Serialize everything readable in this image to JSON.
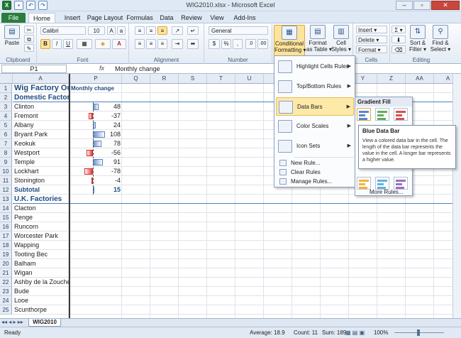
{
  "window": {
    "title": "WIG2010.xlsx  -  Microsoft Excel",
    "minimize": "–",
    "restore": "▫",
    "close": "✕"
  },
  "tabs": [
    "File",
    "Home",
    "Insert",
    "Page Layout",
    "Formulas",
    "Data",
    "Review",
    "View",
    "Add-Ins"
  ],
  "ribbon": {
    "clipboard": {
      "label": "Clipboard",
      "paste": "Paste"
    },
    "font": {
      "label": "Font",
      "name": "Calibri",
      "size": "10",
      "bold": "B",
      "italic": "I",
      "underline": "U"
    },
    "alignment": {
      "label": "Alignment"
    },
    "number": {
      "label": "Number",
      "format": "General",
      "currency": "$",
      "percent": "%",
      "comma": ",",
      "inc": ".0",
      "dec": ".00"
    },
    "styles": {
      "conditional": "Conditional\nFormatting ▾",
      "format_table": "Format\nas Table ▾",
      "cell_styles": "Cell\nStyles ▾"
    },
    "cells": {
      "label": "Cells",
      "insert": "Insert ▾",
      "delete": "Delete ▾",
      "format": "Format ▾"
    },
    "editing": {
      "label": "Editing",
      "sum": "Σ ▾",
      "sort": "Sort &\nFilter ▾",
      "find": "Find &\nSelect ▾"
    }
  },
  "formula_bar": {
    "name_box": "P1",
    "fx": "fx",
    "value": "Monthly change"
  },
  "columns": [
    "A",
    "P",
    "Q",
    "R",
    "S",
    "T",
    "U",
    "V",
    "W",
    "X",
    "Y",
    "Z",
    "AA",
    "A"
  ],
  "rows": [
    {
      "n": "1",
      "a": "Wig Factory Ou",
      "p": "Monthly change",
      "v": null,
      "style": "title"
    },
    {
      "n": "2",
      "a": "Domestic Factories",
      "p": "",
      "v": null,
      "style": "section"
    },
    {
      "n": "3",
      "a": "Clinton",
      "v": 48
    },
    {
      "n": "4",
      "a": "Fremont",
      "v": -37
    },
    {
      "n": "5",
      "a": "Albany",
      "v": 24
    },
    {
      "n": "6",
      "a": "Bryant Park",
      "v": 108
    },
    {
      "n": "7",
      "a": "Keokuk",
      "v": 78
    },
    {
      "n": "8",
      "a": "Westport",
      "v": -56
    },
    {
      "n": "9",
      "a": "Temple",
      "v": 91
    },
    {
      "n": "10",
      "a": "Lockhart",
      "v": -78
    },
    {
      "n": "11",
      "a": "Stonington",
      "v": -4
    },
    {
      "n": "12",
      "a": "Subtotal",
      "v": 15,
      "style": "subtotal"
    },
    {
      "n": "13",
      "a": "U.K. Factories",
      "v": null,
      "style": "section"
    },
    {
      "n": "14",
      "a": "Clacton",
      "v": null
    },
    {
      "n": "15",
      "a": "Penge",
      "v": null
    },
    {
      "n": "16",
      "a": "Runcorn",
      "v": null
    },
    {
      "n": "17",
      "a": "Worcester Park",
      "v": null
    },
    {
      "n": "18",
      "a": "Wapping",
      "v": null
    },
    {
      "n": "19",
      "a": "Tooting Bec",
      "v": null
    },
    {
      "n": "20",
      "a": "Balham",
      "v": null
    },
    {
      "n": "21",
      "a": "Wigan",
      "v": null
    },
    {
      "n": "22",
      "a": "Ashby de la Zouche",
      "v": null
    },
    {
      "n": "23",
      "a": "Bude",
      "v": null
    },
    {
      "n": "24",
      "a": "Looe",
      "v": null
    },
    {
      "n": "25",
      "a": "Scunthorpe",
      "v": null
    }
  ],
  "menu": {
    "items": [
      "Highlight Cells Rules",
      "Top/Bottom Rules",
      "Data Bars",
      "Color Scales",
      "Icon Sets"
    ],
    "small": [
      "New Rule...",
      "Clear Rules",
      "Manage Rules..."
    ]
  },
  "submenu": {
    "header": "Gradient Fill",
    "more": "More Rules..."
  },
  "tooltip": {
    "title": "Blue Data Bar",
    "body": "View a colored data bar in the cell. The length of the data bar represents the value in the cell. A longer bar represents a higher value."
  },
  "sheet_tab": "WIG2010",
  "status": {
    "ready": "Ready",
    "average": "Average: 18.9",
    "count": "Count: 11",
    "sum": "Sum: 189",
    "zoom": "100%"
  },
  "colors": {
    "accent": "#4f81bd",
    "positive_bar": "#6d93cc",
    "negative_bar": "#e53333",
    "highlight": "#fde49a"
  }
}
